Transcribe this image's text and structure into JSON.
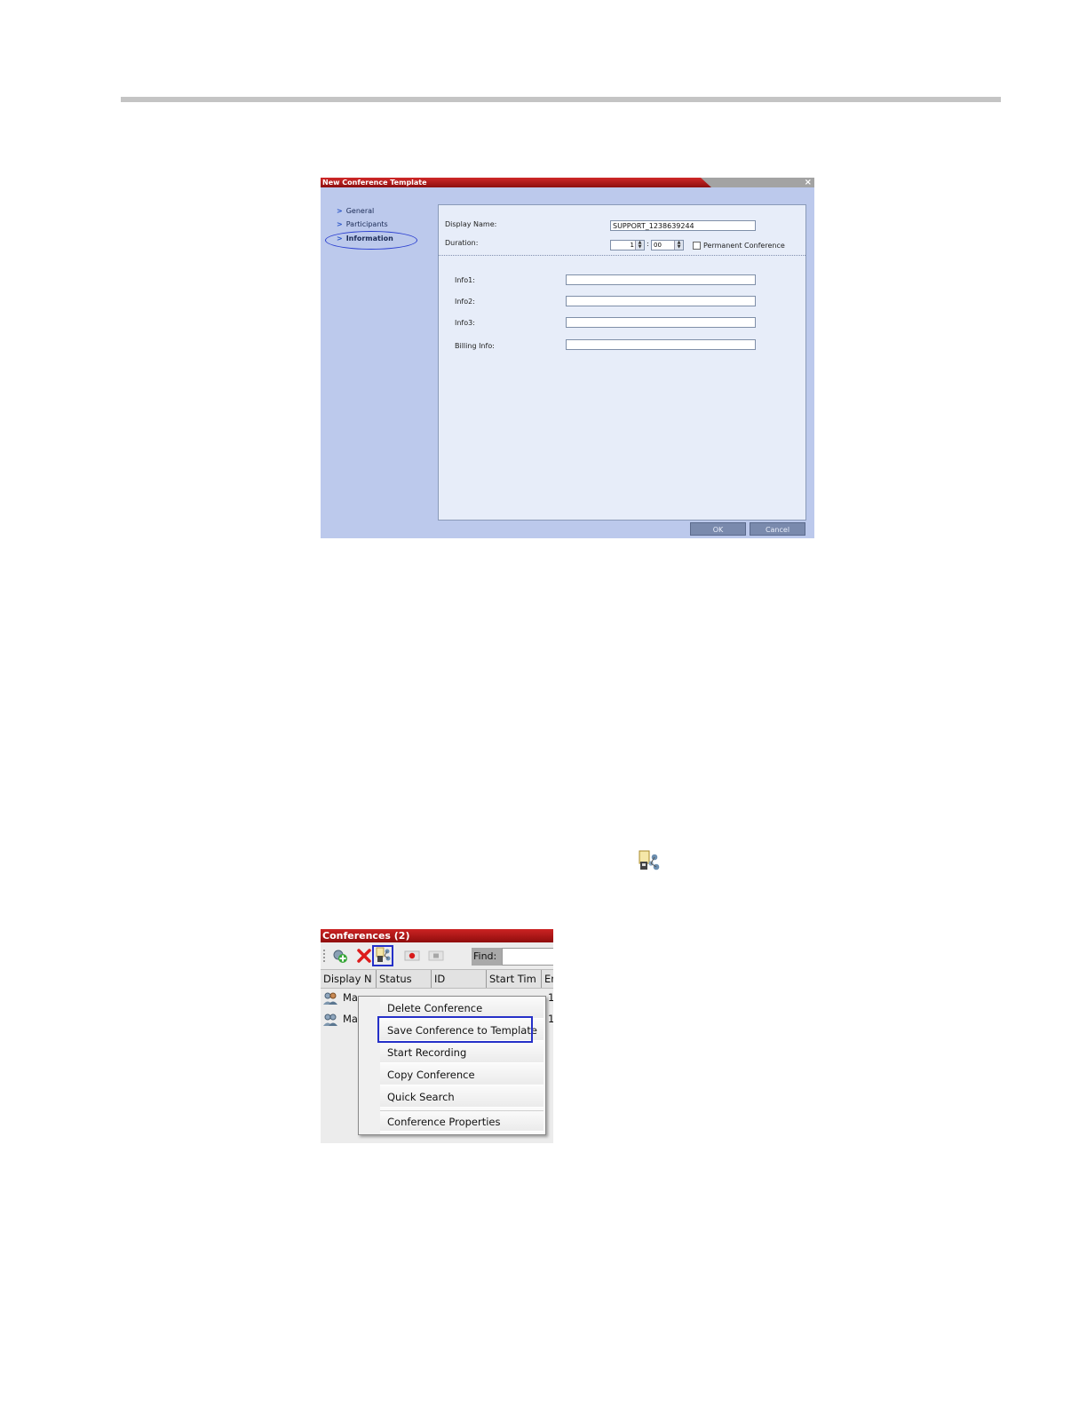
{
  "dialog": {
    "title": "New Conference Template",
    "close": "×",
    "nav": [
      "General",
      "Participants",
      "Information"
    ],
    "active_nav": "Information",
    "display_name_label": "Display Name:",
    "display_name_value": "SUPPORT_1238639244",
    "duration_label": "Duration:",
    "duration_hours": "1",
    "duration_minutes": "00",
    "duration_sep": ":",
    "permanent_label": "Permanent Conference",
    "info1_label": "Info1:",
    "info2_label": "Info2:",
    "info3_label": "Info3:",
    "billing_label": "Billing Info:",
    "ok": "OK",
    "cancel": "Cancel"
  },
  "conferences": {
    "title": "Conferences (2)",
    "find_label": "Find:",
    "columns": [
      "Display N",
      "Status",
      "ID",
      "Start Tim",
      "En"
    ],
    "rows": [
      {
        "name": "Ma",
        "tail": "1"
      },
      {
        "name": "Ma",
        "tail": "1"
      }
    ]
  },
  "context_menu": {
    "items": [
      "Delete Conference",
      "Save Conference to Template",
      "Start Recording",
      "Copy Conference",
      "Quick Search",
      "Conference Properties"
    ],
    "highlighted": "Save Conference to Template"
  },
  "icons": {
    "inline": "save-conference-to-template-icon",
    "toolbar": [
      "new-conference-icon",
      "delete-conference-icon",
      "save-to-template-icon",
      "start-recording-icon",
      "stop-recording-icon"
    ]
  }
}
